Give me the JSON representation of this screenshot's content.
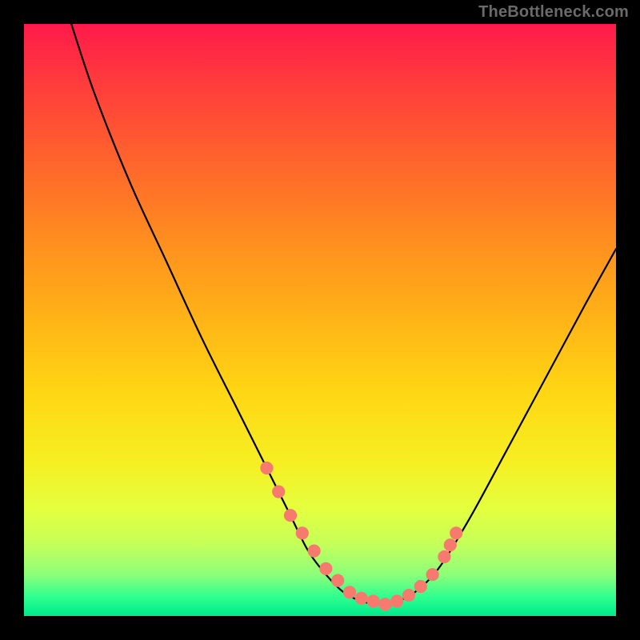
{
  "watermark": "TheBottleneck.com",
  "chart_data": {
    "type": "line",
    "title": "",
    "xlabel": "",
    "ylabel": "",
    "xlim": [
      0,
      100
    ],
    "ylim": [
      0,
      100
    ],
    "grid": false,
    "legend": null,
    "note": "Bottleneck curve rendered over a red→yellow→green vertical gradient. Valley (optimal) near the bottom-center; curve rises steeply to upper-left from origin and moderately to the right.",
    "series": [
      {
        "name": "bottleneck-curve",
        "color": "#000000",
        "x": [
          8,
          12,
          18,
          24,
          30,
          36,
          41,
          45,
          48,
          51,
          54,
          57,
          60,
          63,
          66,
          70,
          75,
          81,
          88,
          95,
          100
        ],
        "y": [
          100,
          88,
          73,
          60,
          47,
          35,
          25,
          17,
          11,
          7,
          4,
          2.5,
          2,
          2.5,
          4,
          8,
          16,
          27,
          40,
          53,
          62
        ]
      }
    ],
    "markers": {
      "name": "valley-dots",
      "color": "#f77a6f",
      "note": "Salmon-colored dotted segments near the valley on both flanks and along the floor.",
      "x": [
        41,
        43,
        45,
        47,
        49,
        51,
        53,
        55,
        57,
        59,
        61,
        63,
        65,
        67,
        69,
        71,
        72,
        73
      ],
      "y": [
        25,
        21,
        17,
        14,
        11,
        8,
        6,
        4,
        3,
        2.5,
        2,
        2.5,
        3.5,
        5,
        7,
        10,
        12,
        14
      ],
      "r": 1.1
    },
    "gradient_stops": [
      {
        "offset": 0,
        "color": "#ff1a4a"
      },
      {
        "offset": 25,
        "color": "#ff6a2a"
      },
      {
        "offset": 50,
        "color": "#ffb416"
      },
      {
        "offset": 74,
        "color": "#f6ef22"
      },
      {
        "offset": 93,
        "color": "#8cff7a"
      },
      {
        "offset": 100,
        "color": "#00e88a"
      }
    ]
  }
}
